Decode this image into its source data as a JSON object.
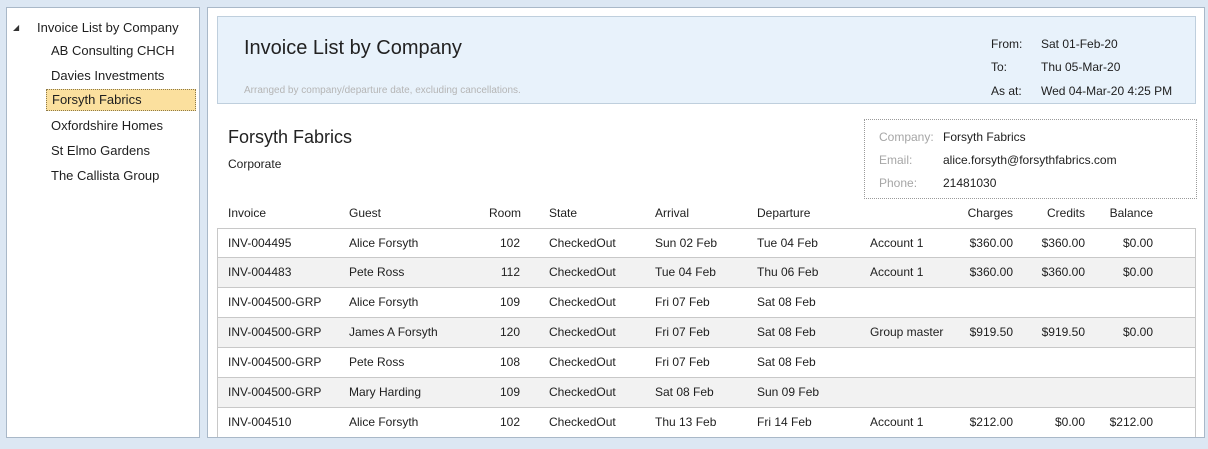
{
  "tree": {
    "root_label": "Invoice List by Company",
    "toggle_icon": "◢",
    "items": [
      {
        "label": "AB Consulting CHCH"
      },
      {
        "label": "Davies Investments"
      },
      {
        "label": "Forsyth Fabrics"
      },
      {
        "label": "Oxfordshire Homes"
      },
      {
        "label": "St Elmo Gardens"
      },
      {
        "label": "The Callista Group"
      }
    ],
    "selected": "Forsyth Fabrics"
  },
  "report": {
    "title": "Invoice List by Company",
    "subtitle": "Arranged by company/departure date, excluding cancellations.",
    "from_label": "From:",
    "from_value": "Sat 01-Feb-20",
    "to_label": "To:",
    "to_value": "Thu 05-Mar-20",
    "asat_label": "As at:",
    "asat_value": "Wed 04-Mar-20 4:25 PM"
  },
  "company": {
    "name": "Forsyth Fabrics",
    "type": "Corporate",
    "company_label": "Company:",
    "company_value": "Forsyth Fabrics",
    "email_label": "Email:",
    "email_value": "alice.forsyth@forsythfabrics.com",
    "phone_label": "Phone:",
    "phone_value": "21481030"
  },
  "table": {
    "columns": {
      "invoice": "Invoice",
      "guest": "Guest",
      "room": "Room",
      "state": "State",
      "arrival": "Arrival",
      "departure": "Departure",
      "charges": "Charges",
      "credits": "Credits",
      "balance": "Balance"
    },
    "rows": [
      {
        "invoice": "INV-004495",
        "guest": "Alice Forsyth",
        "room": "102",
        "state": "CheckedOut",
        "arrival": "Sun 02 Feb",
        "departure": "Tue 04 Feb",
        "account": "Account 1",
        "charges": "$360.00",
        "credits": "$360.00",
        "balance": "$0.00"
      },
      {
        "invoice": "INV-004483",
        "guest": "Pete Ross",
        "room": "112",
        "state": "CheckedOut",
        "arrival": "Tue 04 Feb",
        "departure": "Thu 06 Feb",
        "account": "Account 1",
        "charges": "$360.00",
        "credits": "$360.00",
        "balance": "$0.00"
      },
      {
        "invoice": "INV-004500-GRP",
        "guest": "Alice Forsyth",
        "room": "109",
        "state": "CheckedOut",
        "arrival": "Fri 07 Feb",
        "departure": "Sat 08 Feb",
        "account": "",
        "charges": "",
        "credits": "",
        "balance": ""
      },
      {
        "invoice": "INV-004500-GRP",
        "guest": "James A Forsyth",
        "room": "120",
        "state": "CheckedOut",
        "arrival": "Fri 07 Feb",
        "departure": "Sat 08 Feb",
        "account": "Group master",
        "charges": "$919.50",
        "credits": "$919.50",
        "balance": "$0.00"
      },
      {
        "invoice": "INV-004500-GRP",
        "guest": "Pete Ross",
        "room": "108",
        "state": "CheckedOut",
        "arrival": "Fri 07 Feb",
        "departure": "Sat 08 Feb",
        "account": "",
        "charges": "",
        "credits": "",
        "balance": ""
      },
      {
        "invoice": "INV-004500-GRP",
        "guest": "Mary Harding",
        "room": "109",
        "state": "CheckedOut",
        "arrival": "Sat 08 Feb",
        "departure": "Sun 09 Feb",
        "account": "",
        "charges": "",
        "credits": "",
        "balance": ""
      },
      {
        "invoice": "INV-004510",
        "guest": "Alice Forsyth",
        "room": "102",
        "state": "CheckedOut",
        "arrival": "Thu 13 Feb",
        "departure": "Fri 14 Feb",
        "account": "Account 1",
        "charges": "$212.00",
        "credits": "$0.00",
        "balance": "$212.00"
      }
    ]
  }
}
